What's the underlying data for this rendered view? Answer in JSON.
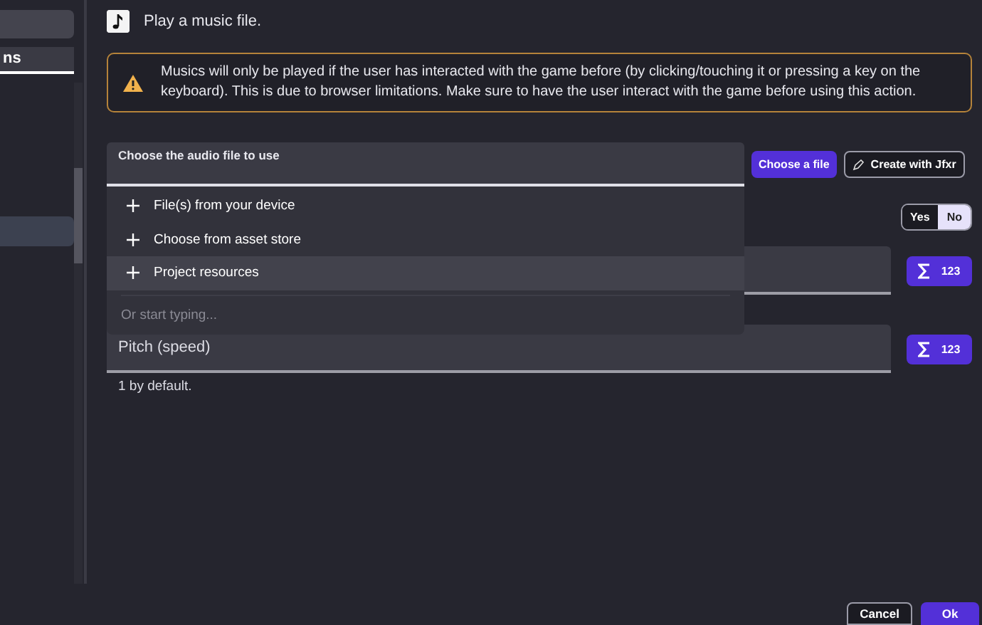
{
  "sidebar": {
    "tab": {
      "label": "ns",
      "selected": true
    },
    "list_items": [
      {
        "selected": true
      }
    ]
  },
  "header": {
    "title": "Play a music file."
  },
  "warning": {
    "text": "Musics will only be played if the user has interacted with the game before (by clicking/touching it or pressing a key on the keyboard). This is due to browser limitations. Make sure to have the user interact with the game before using this action."
  },
  "audio_field": {
    "label": "Choose the audio file to use"
  },
  "audio_buttons": [
    {
      "label": "Choose a file",
      "kind": "primary"
    },
    {
      "label": "Create with Jfxr",
      "kind": "outline"
    }
  ],
  "dropdown": {
    "items": [
      {
        "label": "File(s) from your device",
        "selected": false
      },
      {
        "label": "Choose from asset store",
        "selected": false
      },
      {
        "label": "Project resources",
        "selected": true
      }
    ],
    "placeholder": "Or start typing..."
  },
  "toggle": [
    {
      "label": "Yes",
      "selected": false
    },
    {
      "label": "No",
      "selected": true
    }
  ],
  "fields": [
    {
      "expression_label": "123"
    },
    {
      "label": "Pitch (speed)",
      "help": "1 by default.",
      "expression_label": "123"
    }
  ],
  "footer": {
    "buttons": [
      {
        "label": "Cancel",
        "kind": "outline"
      },
      {
        "label": "Ok",
        "kind": "primary"
      }
    ]
  }
}
